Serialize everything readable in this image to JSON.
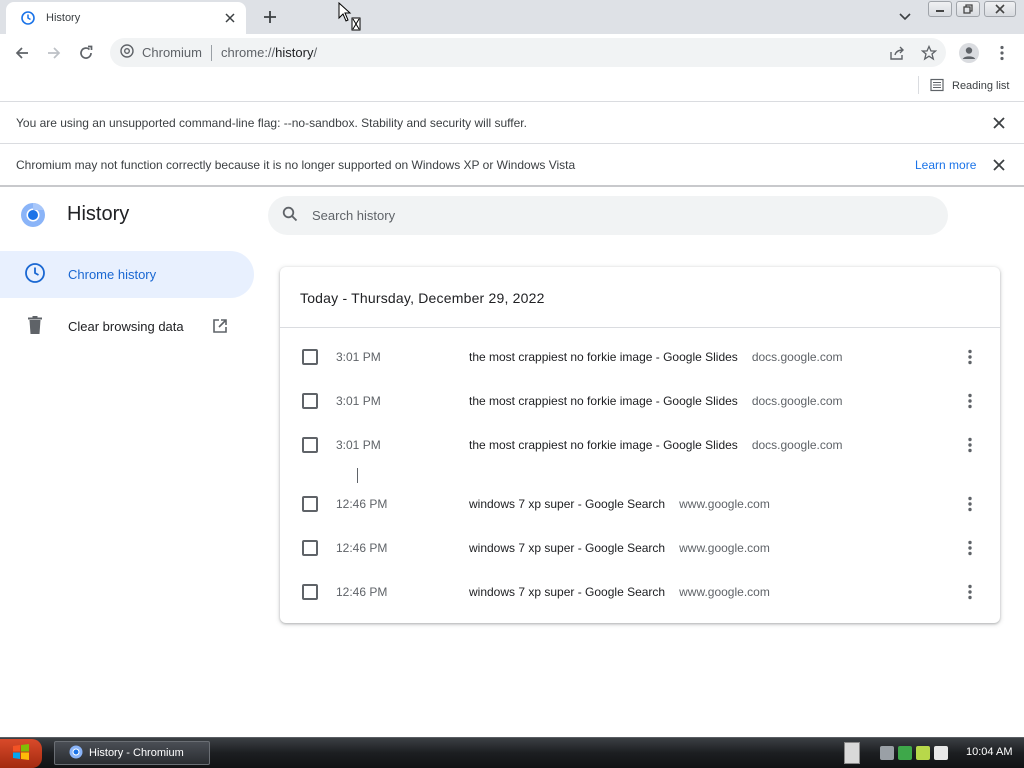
{
  "tab": {
    "title": "History"
  },
  "toolbar": {
    "site_label": "Chromium",
    "url_prefix": "chrome://",
    "url_host": "history",
    "url_suffix": "/"
  },
  "bookmarks_bar": {
    "reading_list_label": "Reading list"
  },
  "infobars": [
    {
      "message": "You are using an unsupported command-line flag: --no-sandbox. Stability and security will suffer."
    },
    {
      "message": "Chromium may not function correctly because it is no longer supported on Windows XP or Windows Vista",
      "link": "Learn more"
    }
  ],
  "page": {
    "title": "History",
    "search_placeholder": "Search history",
    "nav": [
      {
        "label": "Chrome history",
        "icon": "clock-icon",
        "active": true
      },
      {
        "label": "Clear browsing data",
        "icon": "trash-icon",
        "active": false
      }
    ],
    "date_header": "Today - Thursday, December 29, 2022",
    "entries": [
      {
        "time": "3:01 PM",
        "title": "the most crappiest no forkie image - Google Slides",
        "domain": "docs.google.com"
      },
      {
        "time": "3:01 PM",
        "title": "the most crappiest no forkie image - Google Slides",
        "domain": "docs.google.com"
      },
      {
        "time": "3:01 PM",
        "title": "the most crappiest no forkie image - Google Slides",
        "domain": "docs.google.com"
      },
      {
        "time": "12:46 PM",
        "title": "windows 7 xp super - Google Search",
        "domain": "www.google.com"
      },
      {
        "time": "12:46 PM",
        "title": "windows 7 xp super - Google Search",
        "domain": "www.google.com"
      },
      {
        "time": "12:46 PM",
        "title": "windows 7 xp super - Google Search",
        "domain": "www.google.com"
      }
    ]
  },
  "taskbar": {
    "task_label": "History - Chromium",
    "clock": "10:04 AM"
  },
  "colors": {
    "accent": "#1a73e8",
    "active_nav_bg": "#e8f0fe",
    "tabstrip_bg": "#dee1e6"
  }
}
